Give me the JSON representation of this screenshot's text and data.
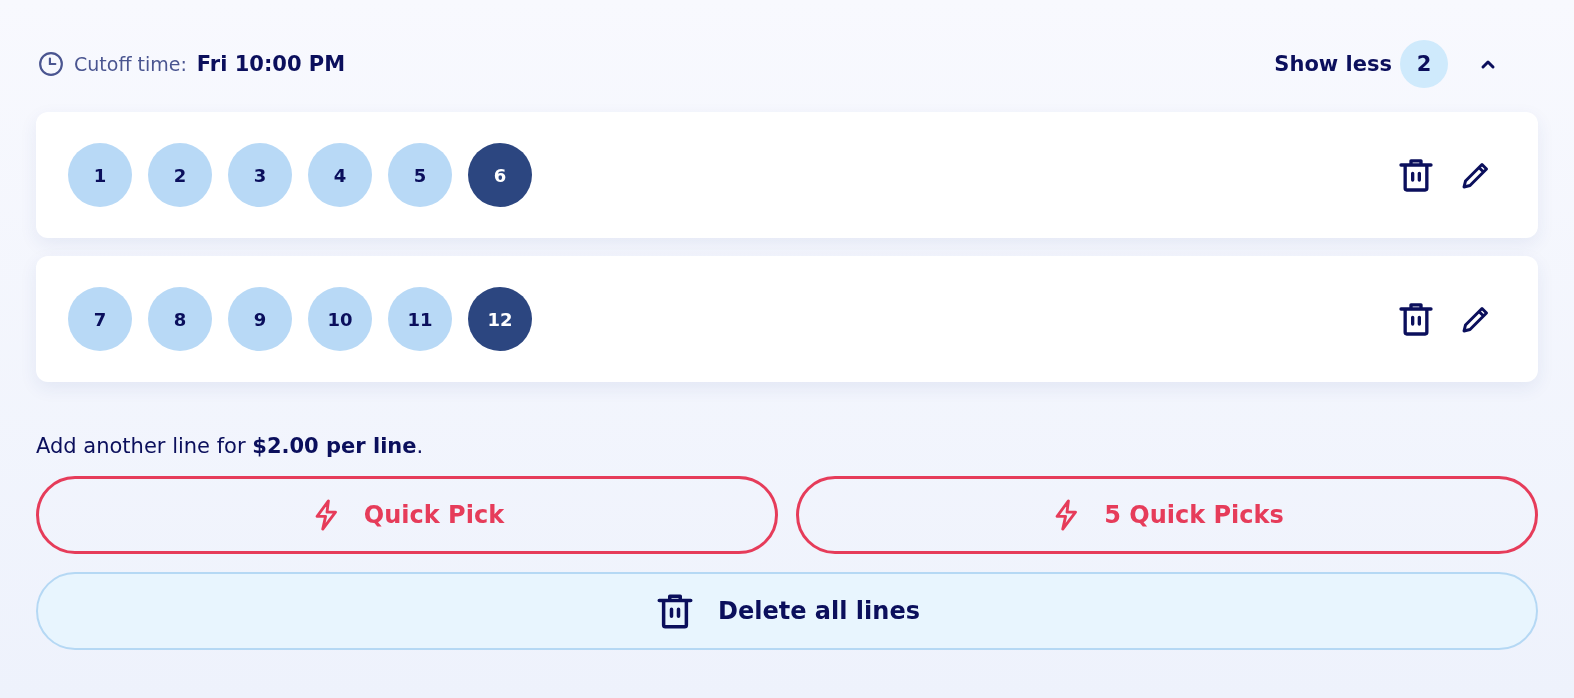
{
  "cutoff": {
    "label": "Cutoff time:",
    "value": "Fri 10:00 PM"
  },
  "toggle": {
    "label": "Show less",
    "count": "2",
    "expanded": true
  },
  "lines": [
    {
      "numbers": [
        {
          "value": "1",
          "kind": "main"
        },
        {
          "value": "2",
          "kind": "main"
        },
        {
          "value": "3",
          "kind": "main"
        },
        {
          "value": "4",
          "kind": "main"
        },
        {
          "value": "5",
          "kind": "main"
        },
        {
          "value": "6",
          "kind": "bonus"
        }
      ]
    },
    {
      "numbers": [
        {
          "value": "7",
          "kind": "main"
        },
        {
          "value": "8",
          "kind": "main"
        },
        {
          "value": "9",
          "kind": "main"
        },
        {
          "value": "10",
          "kind": "main"
        },
        {
          "value": "11",
          "kind": "main"
        },
        {
          "value": "12",
          "kind": "bonus"
        }
      ]
    }
  ],
  "note": "Add another line for **$2.00 per line**.",
  "quick_buttons": [
    "Quick Pick",
    "5 Quick Picks"
  ],
  "delete_all": "Delete all lines"
}
